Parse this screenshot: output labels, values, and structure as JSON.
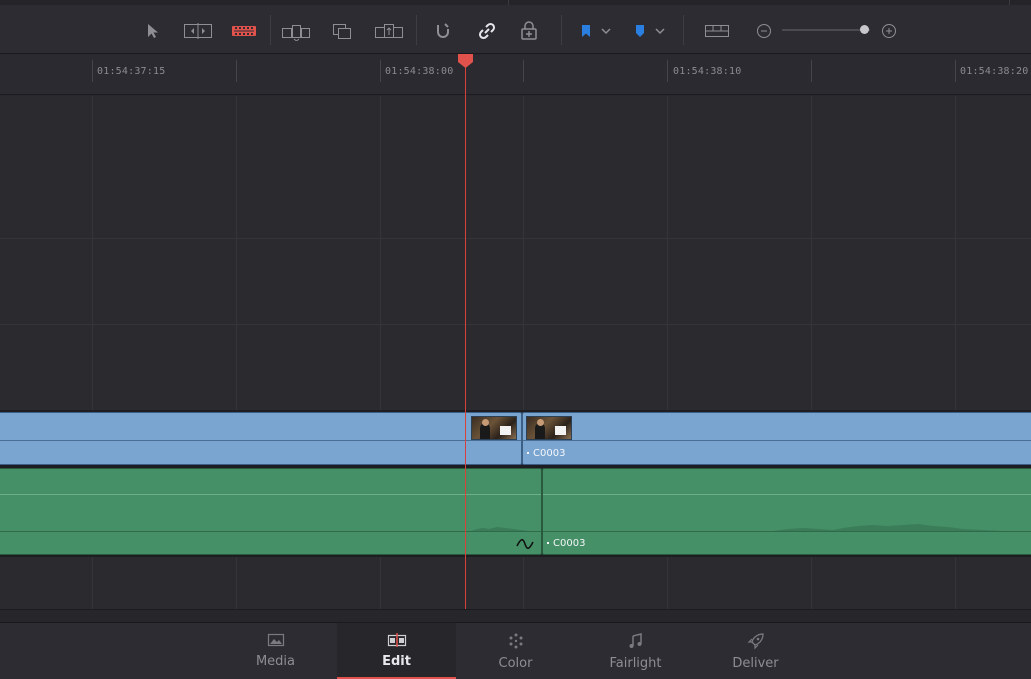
{
  "toolbar": {
    "tools": [
      {
        "name": "selection-mode-icon",
        "active": false
      },
      {
        "name": "trim-edit-mode-icon",
        "active": false
      },
      {
        "name": "blade-edit-mode-icon",
        "active": true
      },
      {
        "name": "insert-clip-icon",
        "active": false
      },
      {
        "name": "overwrite-clip-icon",
        "active": false
      },
      {
        "name": "replace-clip-icon",
        "active": false
      },
      {
        "name": "snapping-icon",
        "active": false
      },
      {
        "name": "linked-selection-icon",
        "active": true
      },
      {
        "name": "position-lock-icon",
        "active": false
      },
      {
        "name": "flag-icon",
        "active": false
      },
      {
        "name": "marker-icon",
        "active": false
      },
      {
        "name": "timeline-view-options-icon",
        "active": false
      },
      {
        "name": "zoom-out-icon",
        "active": false
      },
      {
        "name": "zoom-in-icon",
        "active": false
      }
    ],
    "flag_color": "#2b7fe0",
    "marker_color": "#2b7fe0",
    "blade_color": "#e0524b",
    "zoom_level": 0.93
  },
  "ruler": {
    "timecodes": [
      "01:54:37:15",
      "01:54:38:00",
      "01:54:38:10",
      "01:54:38:20"
    ]
  },
  "timeline": {
    "playhead_color": "#d8413a",
    "video_clips": [
      {
        "label": ""
      },
      {
        "label": "C0003"
      }
    ],
    "audio_clips": [
      {
        "label": ""
      },
      {
        "label": "C0003"
      }
    ],
    "video_color": "#7aa5d1",
    "audio_color": "#459066"
  },
  "pages": [
    {
      "label": "Media",
      "icon": "media-page-icon",
      "active": false
    },
    {
      "label": "Edit",
      "icon": "edit-page-icon",
      "active": true
    },
    {
      "label": "Color",
      "icon": "color-page-icon",
      "active": false
    },
    {
      "label": "Fairlight",
      "icon": "fairlight-page-icon",
      "active": false
    },
    {
      "label": "Deliver",
      "icon": "deliver-page-icon",
      "active": false
    }
  ]
}
